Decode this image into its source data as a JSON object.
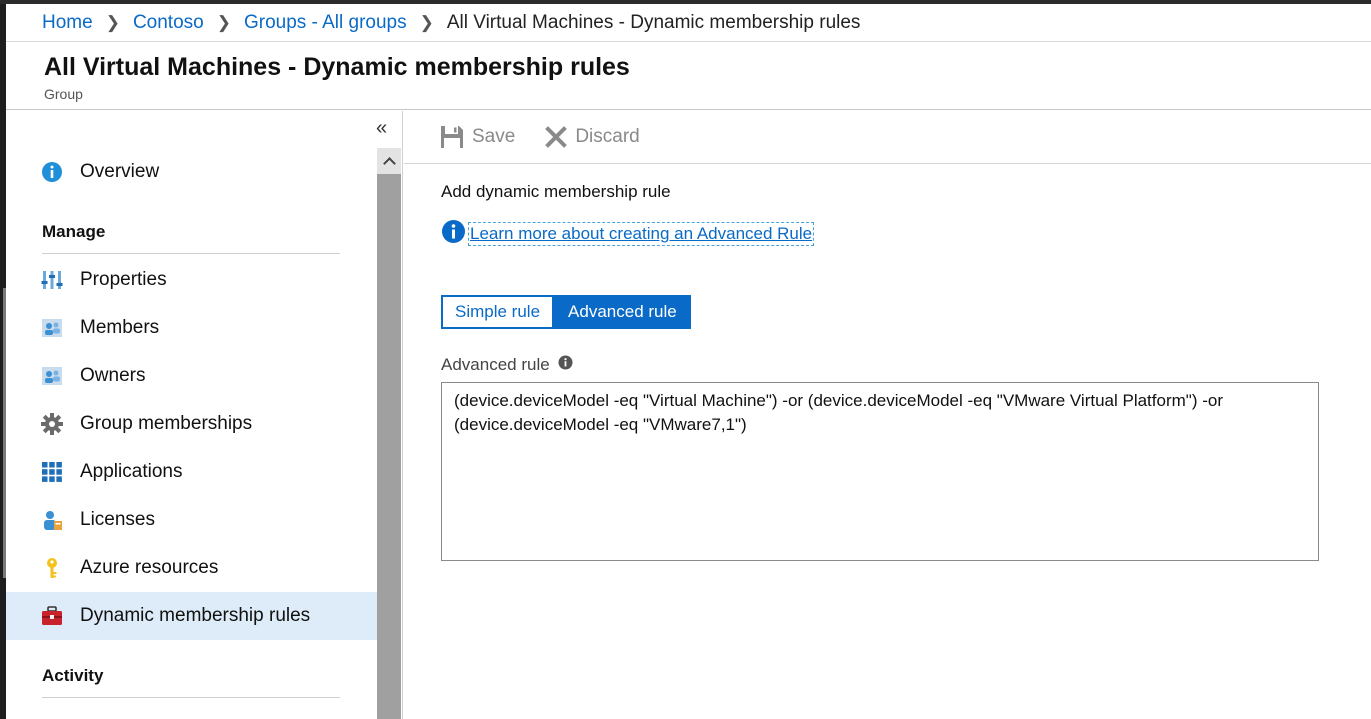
{
  "breadcrumb": {
    "home": "Home",
    "tenant": "Contoso",
    "groups": "Groups - All groups",
    "current": "All Virtual Machines - Dynamic membership rules"
  },
  "header": {
    "title": "All Virtual Machines - Dynamic membership rules",
    "subtitle": "Group"
  },
  "sidebar": {
    "overview": "Overview",
    "manage_heading": "Manage",
    "properties": "Properties",
    "members": "Members",
    "owners": "Owners",
    "group_memberships": "Group memberships",
    "applications": "Applications",
    "licenses": "Licenses",
    "azure_resources": "Azure resources",
    "dynamic_rules": "Dynamic membership rules",
    "activity_heading": "Activity"
  },
  "toolbar": {
    "save": "Save",
    "discard": "Discard"
  },
  "main": {
    "add_label": "Add dynamic membership rule",
    "learn_more": "Learn more about creating an Advanced Rule",
    "simple_rule": "Simple rule",
    "advanced_rule": "Advanced rule",
    "rule_label": "Advanced rule",
    "rule_text": "(device.deviceModel -eq \"Virtual Machine\") -or (device.deviceModel -eq \"VMware Virtual Platform\") -or\n(device.deviceModel -eq \"VMware7,1\")"
  },
  "colors": {
    "accent": "#0a6ac7",
    "active_nav_bg": "#ddecf8"
  }
}
